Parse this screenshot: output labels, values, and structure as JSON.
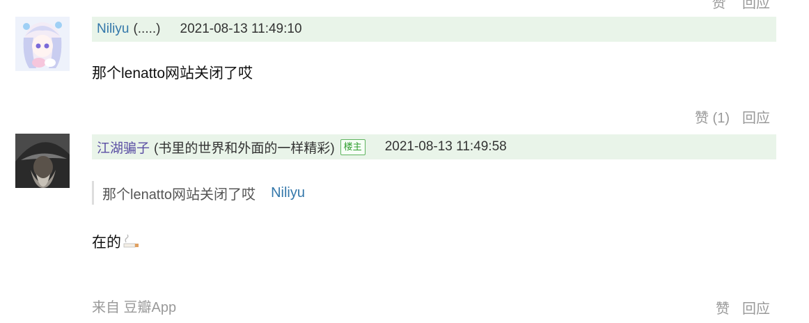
{
  "prev_footer": {
    "actions": [
      "赞",
      "回应"
    ]
  },
  "comments": [
    {
      "author": "Niliyu",
      "signature": "(.....)",
      "time": "2021-08-13 11:49:10",
      "text": "那个lenatto网站关闭了哎",
      "like_label": "赞 (1)",
      "reply_label": "回应"
    },
    {
      "author": "江湖骗子",
      "signature": "(书里的世界和外面的一样精彩)",
      "badge": "楼主",
      "time": "2021-08-13 11:49:58",
      "quote": {
        "text": "那个lenatto网站关闭了哎",
        "author": "Niliyu"
      },
      "text": "在的",
      "from": "来自 豆瓣App",
      "like_label": "赞",
      "reply_label": "回应"
    }
  ]
}
